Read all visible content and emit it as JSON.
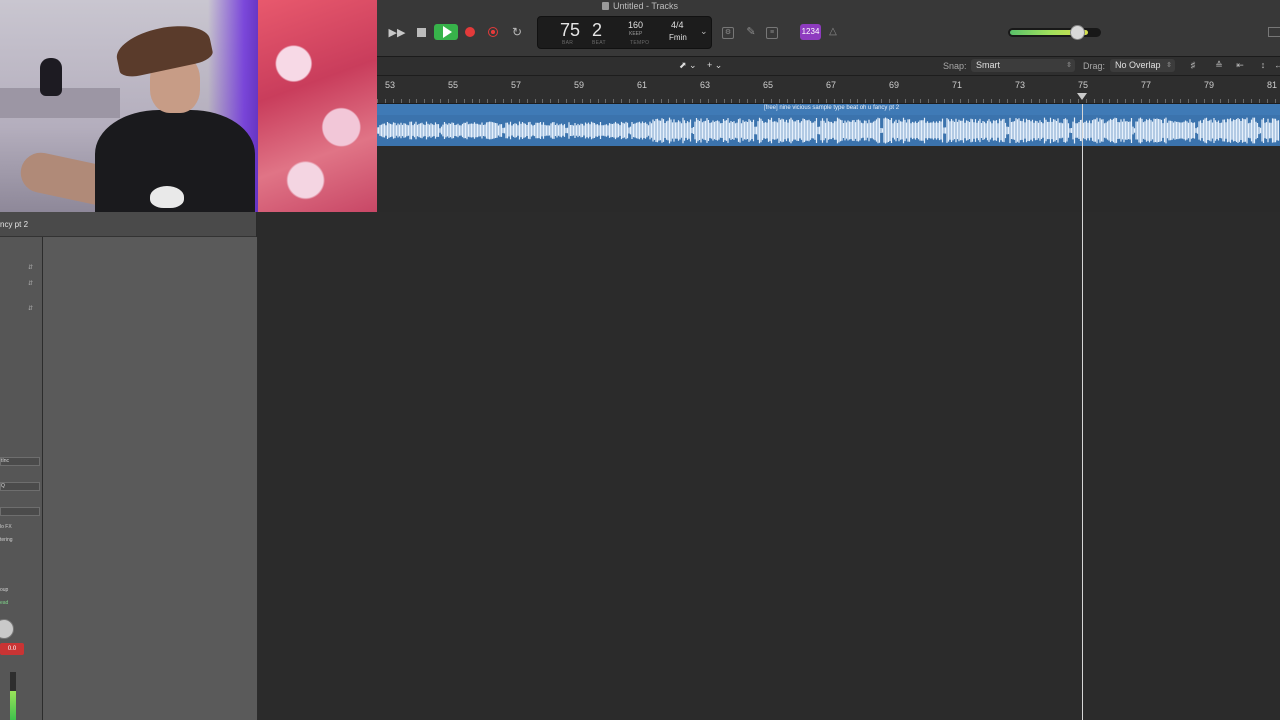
{
  "window": {
    "title": "Untitled - Tracks"
  },
  "transport": {
    "fast_forward_icon": "fast-forward-icon",
    "lcd": {
      "bar": "75",
      "beat": "2",
      "bar_caption": "BAR",
      "beat_caption": "BEAT",
      "tempo": "160",
      "keep": "KEEP",
      "tempo_caption": "TEMPO",
      "time_signature": "4/4",
      "key": "Fmin"
    },
    "count_in": "1234"
  },
  "toolbar": {
    "snap_label": "Snap:",
    "snap_value": "Smart",
    "drag_label": "Drag:",
    "drag_value": "No Overlap"
  },
  "ruler": {
    "bars": [
      "53",
      "55",
      "57",
      "59",
      "61",
      "63",
      "65",
      "67",
      "69",
      "71",
      "73",
      "75",
      "77",
      "79",
      "81"
    ]
  },
  "region": {
    "name": "[free] nine vicious sample type beat oh u fancy pt 2",
    "color": "#3b73ad"
  },
  "inspector": {
    "track_name": "ncy pt 2",
    "text_fx": "lo FX",
    "text_ering": "tering",
    "text_oup": "oup",
    "text_ead": "ead",
    "slot1": "tInc",
    "slot2": "Q",
    "volume_readout": "0.0"
  },
  "playhead": {
    "bar": 75
  }
}
